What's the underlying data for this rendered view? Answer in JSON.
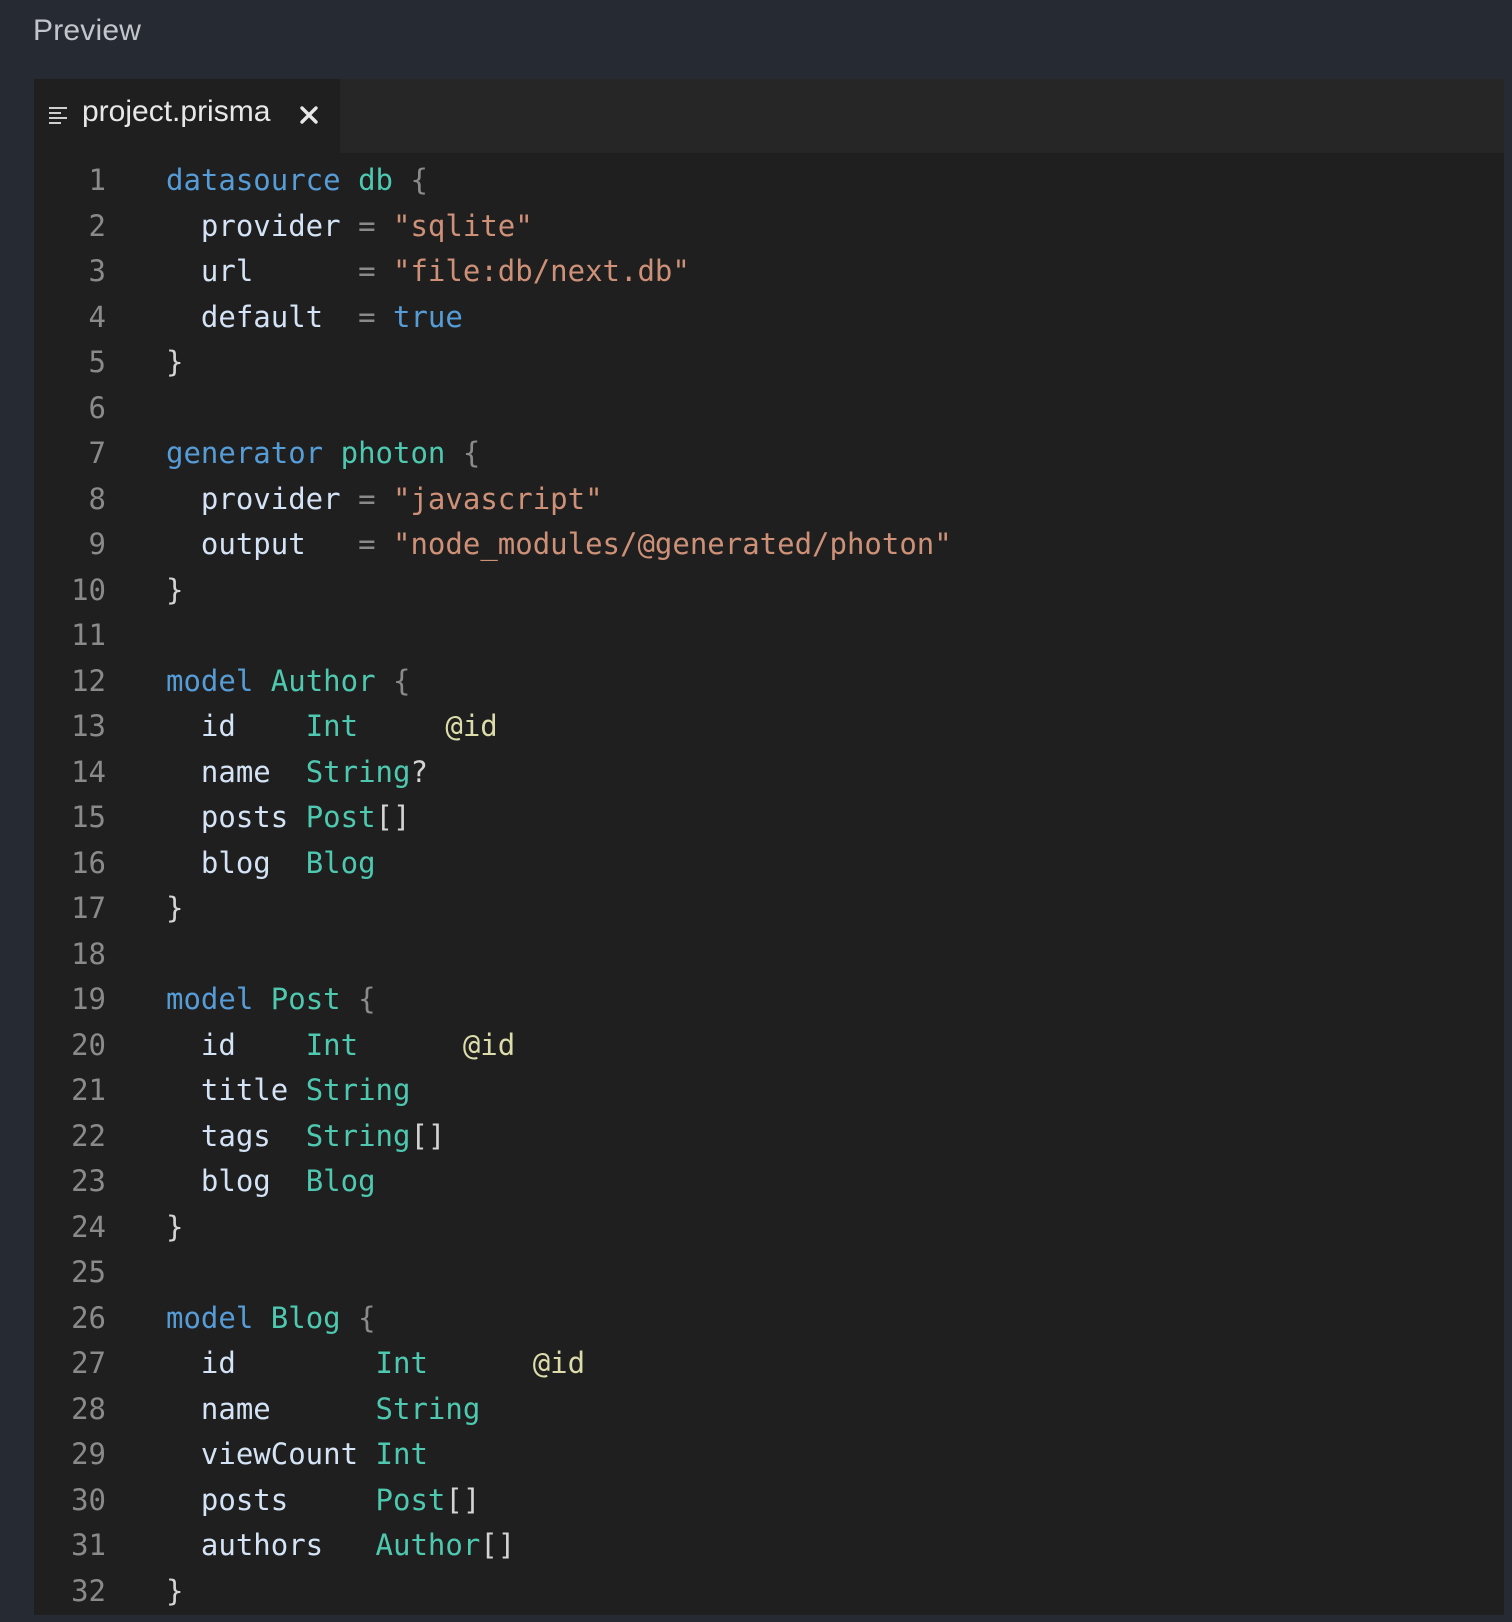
{
  "panel": {
    "title": "Preview"
  },
  "tab": {
    "filename": "project.prisma",
    "file_icon": "lines-icon",
    "close_icon": "close-icon"
  },
  "colors": {
    "keyword": "#569cd6",
    "type": "#4ec9b0",
    "string": "#ce9178",
    "field": "#d4e3f5",
    "attribute": "#dcdcaa",
    "line_number": "#8a8a8a",
    "editor_background": "#1f1f1f",
    "panel_background": "#262a33"
  },
  "code": {
    "lines": [
      {
        "number": "1",
        "tokens": [
          {
            "t": "datasource",
            "c": "keyword"
          },
          {
            "t": " "
          },
          {
            "t": "db",
            "c": "type"
          },
          {
            "t": " "
          },
          {
            "t": "{",
            "c": "brace"
          }
        ]
      },
      {
        "number": "2",
        "tokens": [
          {
            "t": "  "
          },
          {
            "t": "provider",
            "c": "field"
          },
          {
            "t": " "
          },
          {
            "t": "=",
            "c": "op"
          },
          {
            "t": " "
          },
          {
            "t": "\"sqlite\"",
            "c": "string"
          }
        ]
      },
      {
        "number": "3",
        "tokens": [
          {
            "t": "  "
          },
          {
            "t": "url",
            "c": "field"
          },
          {
            "t": "      "
          },
          {
            "t": "=",
            "c": "op"
          },
          {
            "t": " "
          },
          {
            "t": "\"file:db/next.db\"",
            "c": "string"
          }
        ]
      },
      {
        "number": "4",
        "tokens": [
          {
            "t": "  "
          },
          {
            "t": "default",
            "c": "field"
          },
          {
            "t": "  "
          },
          {
            "t": "=",
            "c": "op"
          },
          {
            "t": " "
          },
          {
            "t": "true",
            "c": "keyword"
          }
        ]
      },
      {
        "number": "5",
        "tokens": [
          {
            "t": "}",
            "c": "punct"
          }
        ]
      },
      {
        "number": "6",
        "tokens": []
      },
      {
        "number": "7",
        "tokens": [
          {
            "t": "generator",
            "c": "keyword"
          },
          {
            "t": " "
          },
          {
            "t": "photon",
            "c": "type"
          },
          {
            "t": " "
          },
          {
            "t": "{",
            "c": "brace"
          }
        ]
      },
      {
        "number": "8",
        "tokens": [
          {
            "t": "  "
          },
          {
            "t": "provider",
            "c": "field"
          },
          {
            "t": " "
          },
          {
            "t": "=",
            "c": "op"
          },
          {
            "t": " "
          },
          {
            "t": "\"javascript\"",
            "c": "string"
          }
        ]
      },
      {
        "number": "9",
        "tokens": [
          {
            "t": "  "
          },
          {
            "t": "output",
            "c": "field"
          },
          {
            "t": "   "
          },
          {
            "t": "=",
            "c": "op"
          },
          {
            "t": " "
          },
          {
            "t": "\"node_modules/@generated/photon\"",
            "c": "string"
          }
        ]
      },
      {
        "number": "10",
        "tokens": [
          {
            "t": "}",
            "c": "punct"
          }
        ]
      },
      {
        "number": "11",
        "tokens": []
      },
      {
        "number": "12",
        "tokens": [
          {
            "t": "model",
            "c": "keyword"
          },
          {
            "t": " "
          },
          {
            "t": "Author",
            "c": "type"
          },
          {
            "t": " "
          },
          {
            "t": "{",
            "c": "brace"
          }
        ]
      },
      {
        "number": "13",
        "tokens": [
          {
            "t": "  "
          },
          {
            "t": "id",
            "c": "field"
          },
          {
            "t": "    "
          },
          {
            "t": "Int",
            "c": "type"
          },
          {
            "t": "     "
          },
          {
            "t": "@id",
            "c": "attr"
          }
        ]
      },
      {
        "number": "14",
        "tokens": [
          {
            "t": "  "
          },
          {
            "t": "name",
            "c": "field"
          },
          {
            "t": "  "
          },
          {
            "t": "String",
            "c": "type"
          },
          {
            "t": "?",
            "c": "punct"
          }
        ]
      },
      {
        "number": "15",
        "tokens": [
          {
            "t": "  "
          },
          {
            "t": "posts",
            "c": "field"
          },
          {
            "t": " "
          },
          {
            "t": "Post",
            "c": "type"
          },
          {
            "t": "[]",
            "c": "punct"
          }
        ]
      },
      {
        "number": "16",
        "tokens": [
          {
            "t": "  "
          },
          {
            "t": "blog",
            "c": "field"
          },
          {
            "t": "  "
          },
          {
            "t": "Blog",
            "c": "type"
          }
        ]
      },
      {
        "number": "17",
        "tokens": [
          {
            "t": "}",
            "c": "punct"
          }
        ]
      },
      {
        "number": "18",
        "tokens": []
      },
      {
        "number": "19",
        "tokens": [
          {
            "t": "model",
            "c": "keyword"
          },
          {
            "t": " "
          },
          {
            "t": "Post",
            "c": "type"
          },
          {
            "t": " "
          },
          {
            "t": "{",
            "c": "brace"
          }
        ]
      },
      {
        "number": "20",
        "tokens": [
          {
            "t": "  "
          },
          {
            "t": "id",
            "c": "field"
          },
          {
            "t": "    "
          },
          {
            "t": "Int",
            "c": "type"
          },
          {
            "t": "      "
          },
          {
            "t": "@id",
            "c": "attr"
          }
        ]
      },
      {
        "number": "21",
        "tokens": [
          {
            "t": "  "
          },
          {
            "t": "title",
            "c": "field"
          },
          {
            "t": " "
          },
          {
            "t": "String",
            "c": "type"
          }
        ]
      },
      {
        "number": "22",
        "tokens": [
          {
            "t": "  "
          },
          {
            "t": "tags",
            "c": "field"
          },
          {
            "t": "  "
          },
          {
            "t": "String",
            "c": "type"
          },
          {
            "t": "[]",
            "c": "punct"
          }
        ]
      },
      {
        "number": "23",
        "tokens": [
          {
            "t": "  "
          },
          {
            "t": "blog",
            "c": "field"
          },
          {
            "t": "  "
          },
          {
            "t": "Blog",
            "c": "type"
          }
        ]
      },
      {
        "number": "24",
        "tokens": [
          {
            "t": "}",
            "c": "punct"
          }
        ]
      },
      {
        "number": "25",
        "tokens": []
      },
      {
        "number": "26",
        "tokens": [
          {
            "t": "model",
            "c": "keyword"
          },
          {
            "t": " "
          },
          {
            "t": "Blog",
            "c": "type"
          },
          {
            "t": " "
          },
          {
            "t": "{",
            "c": "brace"
          }
        ]
      },
      {
        "number": "27",
        "tokens": [
          {
            "t": "  "
          },
          {
            "t": "id",
            "c": "field"
          },
          {
            "t": "        "
          },
          {
            "t": "Int",
            "c": "type"
          },
          {
            "t": "      "
          },
          {
            "t": "@id",
            "c": "attr"
          }
        ]
      },
      {
        "number": "28",
        "tokens": [
          {
            "t": "  "
          },
          {
            "t": "name",
            "c": "field"
          },
          {
            "t": "      "
          },
          {
            "t": "String",
            "c": "type"
          }
        ]
      },
      {
        "number": "29",
        "tokens": [
          {
            "t": "  "
          },
          {
            "t": "viewCount",
            "c": "field"
          },
          {
            "t": " "
          },
          {
            "t": "Int",
            "c": "type"
          }
        ]
      },
      {
        "number": "30",
        "tokens": [
          {
            "t": "  "
          },
          {
            "t": "posts",
            "c": "field"
          },
          {
            "t": "     "
          },
          {
            "t": "Post",
            "c": "type"
          },
          {
            "t": "[]",
            "c": "punct"
          }
        ]
      },
      {
        "number": "31",
        "tokens": [
          {
            "t": "  "
          },
          {
            "t": "authors",
            "c": "field"
          },
          {
            "t": "   "
          },
          {
            "t": "Author",
            "c": "type"
          },
          {
            "t": "[]",
            "c": "punct"
          }
        ]
      },
      {
        "number": "32",
        "tokens": [
          {
            "t": "}",
            "c": "punct"
          }
        ]
      }
    ]
  }
}
